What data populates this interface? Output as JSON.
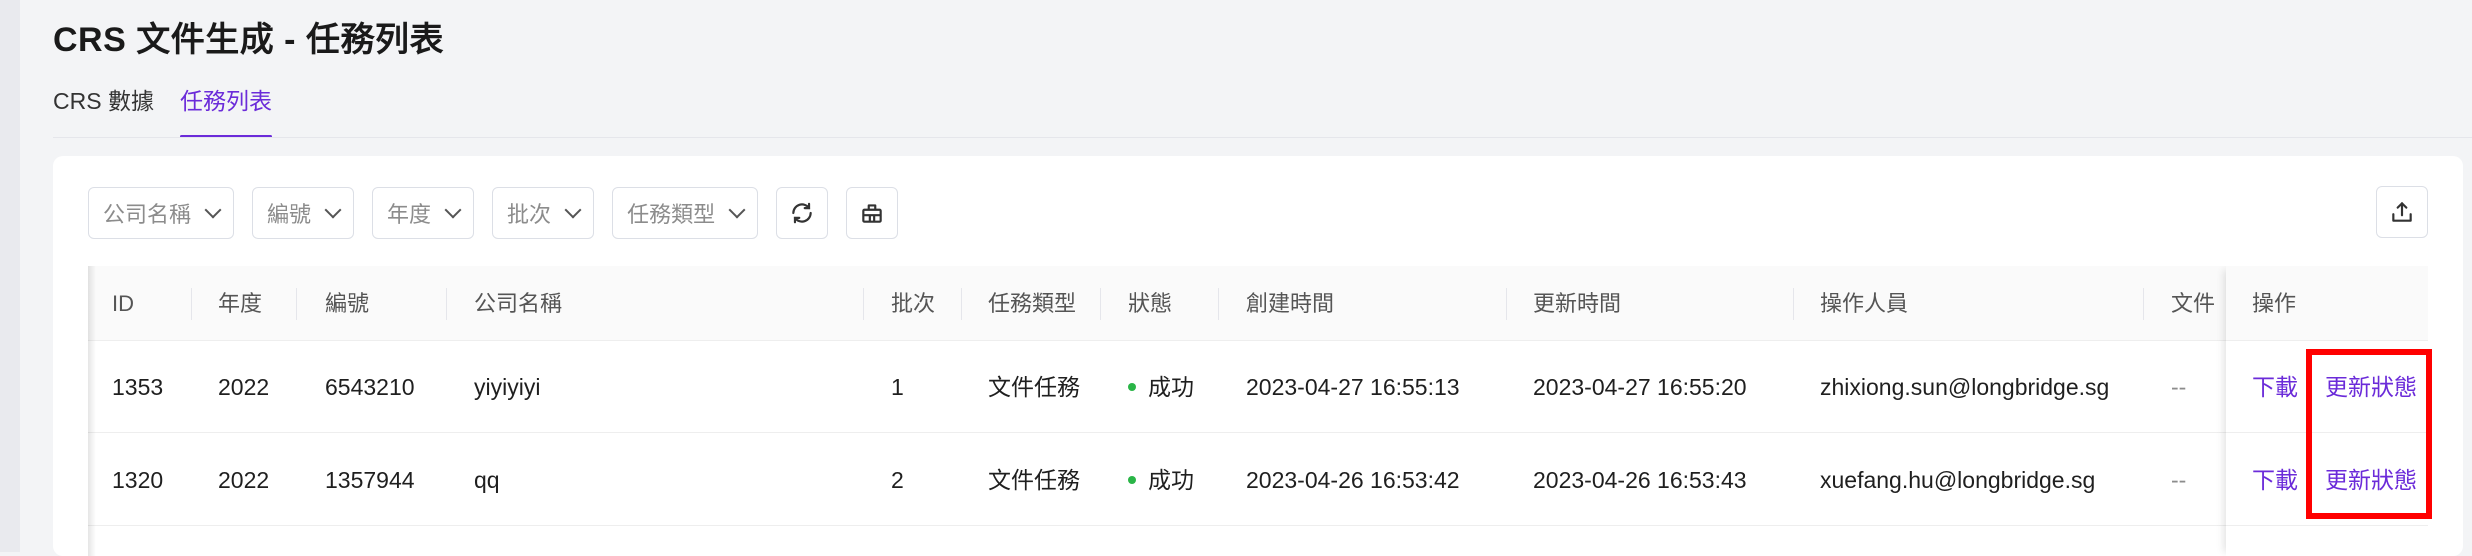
{
  "page": {
    "title": "CRS 文件生成 - 任務列表"
  },
  "tabs": [
    {
      "label": "CRS 數據"
    },
    {
      "label": "任務列表"
    }
  ],
  "filters": [
    {
      "placeholder": "公司名稱"
    },
    {
      "placeholder": "編號"
    },
    {
      "placeholder": "年度"
    },
    {
      "placeholder": "批次"
    },
    {
      "placeholder": "任務類型"
    }
  ],
  "toolbar": {
    "refresh_icon": "refresh-icon",
    "clear_icon": "eraser-icon",
    "export_icon": "export-icon"
  },
  "table": {
    "columns": [
      "ID",
      "年度",
      "編號",
      "公司名稱",
      "批次",
      "任務類型",
      "狀態",
      "創建時間",
      "更新時間",
      "操作人員",
      "文件",
      "操作"
    ],
    "rows": [
      {
        "id": "1353",
        "year": "2022",
        "number": "6543210",
        "company": "yiyiyiyi",
        "batch": "1",
        "task_type": "文件任務",
        "status": "成功",
        "created": "2023-04-27 16:55:13",
        "updated": "2023-04-27 16:55:20",
        "operator": "zhixiong.sun@longbridge.sg",
        "file": "--",
        "action_download": "下載",
        "action_update": "更新狀態"
      },
      {
        "id": "1320",
        "year": "2022",
        "number": "1357944",
        "company": "qq",
        "batch": "2",
        "task_type": "文件任務",
        "status": "成功",
        "created": "2023-04-26 16:53:42",
        "updated": "2023-04-26 16:53:43",
        "operator": "xuefang.hu@longbridge.sg",
        "file": "--",
        "action_download": "下載",
        "action_update": "更新狀態"
      }
    ]
  },
  "colors": {
    "accent": "#6b2bd9",
    "success": "#2ab547",
    "highlight": "#ff0000"
  }
}
